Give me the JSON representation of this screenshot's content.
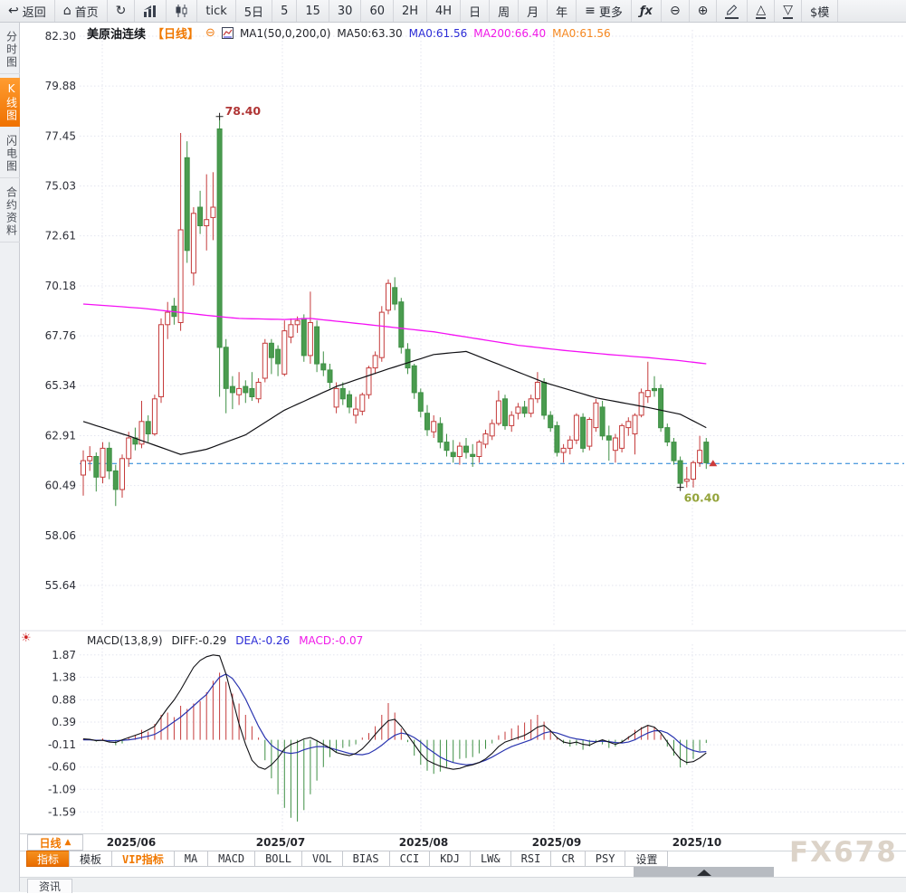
{
  "toolbar": {
    "items": [
      {
        "name": "back-button",
        "icon": "back-arrow-icon",
        "label": "返回"
      },
      {
        "name": "home-button",
        "icon": "home-icon",
        "label": "首页"
      },
      {
        "name": "refresh-button",
        "icon": "refresh-icon"
      },
      {
        "name": "bar-chart-button",
        "icon": "bar-chart-icon"
      },
      {
        "name": "candlestick-button",
        "icon": "candlestick-icon"
      },
      {
        "name": "period-tick-button",
        "label": "tick"
      },
      {
        "name": "period-5day-button",
        "label": "5日"
      },
      {
        "name": "period-5-button",
        "label": "5"
      },
      {
        "name": "period-15-button",
        "label": "15"
      },
      {
        "name": "period-30-button",
        "label": "30"
      },
      {
        "name": "period-60-button",
        "label": "60"
      },
      {
        "name": "period-2h-button",
        "label": "2H"
      },
      {
        "name": "period-4h-button",
        "label": "4H"
      },
      {
        "name": "period-day-button",
        "label": "日"
      },
      {
        "name": "period-week-button",
        "label": "周"
      },
      {
        "name": "period-month-button",
        "label": "月"
      },
      {
        "name": "period-year-button",
        "label": "年"
      },
      {
        "name": "more-button",
        "icon": "menu-icon",
        "label": "更多"
      },
      {
        "name": "fx-indicator-button",
        "icon": "fx-icon"
      },
      {
        "name": "zoom-out-button",
        "icon": "zoom-out-icon"
      },
      {
        "name": "zoom-in-button",
        "icon": "zoom-in-icon"
      },
      {
        "name": "draw-button",
        "icon": "pencil-icon"
      },
      {
        "name": "triangle-up-button",
        "icon": "triangle-up-icon"
      },
      {
        "name": "triangle-down-button",
        "icon": "triangle-down-icon"
      },
      {
        "name": "template-button",
        "label": "$模"
      }
    ]
  },
  "sidebar": {
    "items": [
      {
        "name": "sidebar-item-time-chart",
        "label": "分时图",
        "active": false
      },
      {
        "name": "sidebar-item-kline-chart",
        "label": "K线图",
        "active": true
      },
      {
        "name": "sidebar-item-lightning-chart",
        "label": "闪电图",
        "active": false
      },
      {
        "name": "sidebar-item-contract-info",
        "label": "合约资料",
        "active": false
      }
    ]
  },
  "chart_header": {
    "symbol": "美原油连续",
    "period": "【日线】",
    "ma_settings": "MA1(50,0,200,0)",
    "ma50_label": "MA50:63.30",
    "ma0_blue_label": "MA0:61.56",
    "ma200_label": "MA200:66.40",
    "ma0_orange_label": "MA0:61.56"
  },
  "macd_header": {
    "title": "MACD(13,8,9)",
    "diff_label": "DIFF:-0.29",
    "dea_label": "DEA:-0.26",
    "macd_label": "MACD:-0.07"
  },
  "annotations": {
    "high_label": "78.40",
    "low_label": "60.40"
  },
  "bottom": {
    "period_button": "日线",
    "news_tab": "资讯"
  },
  "tabs": [
    {
      "name": "tab-indicator",
      "label": "指标",
      "active": true,
      "vip": false
    },
    {
      "name": "tab-template",
      "label": "模板",
      "active": false,
      "vip": false
    },
    {
      "name": "tab-vip-indicator",
      "label": "VIP指标",
      "active": false,
      "vip": true
    },
    {
      "name": "tab-ma",
      "label": "MA",
      "active": false,
      "vip": false
    },
    {
      "name": "tab-macd",
      "label": "MACD",
      "active": false,
      "vip": false
    },
    {
      "name": "tab-boll",
      "label": "BOLL",
      "active": false,
      "vip": false
    },
    {
      "name": "tab-vol",
      "label": "VOL",
      "active": false,
      "vip": false
    },
    {
      "name": "tab-bias",
      "label": "BIAS",
      "active": false,
      "vip": false
    },
    {
      "name": "tab-cci",
      "label": "CCI",
      "active": false,
      "vip": false
    },
    {
      "name": "tab-kdj",
      "label": "KDJ",
      "active": false,
      "vip": false
    },
    {
      "name": "tab-lw",
      "label": "LW&",
      "active": false,
      "vip": false
    },
    {
      "name": "tab-rsi",
      "label": "RSI",
      "active": false,
      "vip": false
    },
    {
      "name": "tab-cr",
      "label": "CR",
      "active": false,
      "vip": false
    },
    {
      "name": "tab-psy",
      "label": "PSY",
      "active": false,
      "vip": false
    },
    {
      "name": "tab-settings",
      "label": "设置",
      "active": false,
      "vip": false
    }
  ],
  "watermark": "FX678",
  "colors": {
    "up_candle": "#c53b3b",
    "down_candle": "#4a9c4f",
    "ma50_line": "#101014",
    "ma200_line": "#f410f4",
    "diff_line": "#101014",
    "dea_line": "#2a35b0",
    "current_price_line": "#1a7fd4",
    "accent_orange": "#f07800",
    "high_label": "#b03535",
    "low_label": "#94a43b"
  },
  "chart_data": {
    "type": "candlestick+macd",
    "title": "美原油连续 日线 (WTI crude oil continuous, daily)",
    "y_axis": [
      82.3,
      79.88,
      77.45,
      75.03,
      72.61,
      70.18,
      67.76,
      65.34,
      62.91,
      60.49,
      58.06,
      55.64
    ],
    "macd_axis": [
      1.87,
      1.38,
      0.88,
      0.39,
      -0.11,
      -0.6,
      -1.09,
      -1.59
    ],
    "x_labels": [
      "2025/06",
      "2025/07",
      "2025/08",
      "2025/09",
      "2025/10"
    ],
    "current_price": 61.56,
    "high_marker": {
      "index": 21,
      "price": 78.4
    },
    "low_marker": {
      "index": 92,
      "price": 60.4
    },
    "indicator_values": {
      "ma50": 63.3,
      "ma200": 66.4,
      "ma0": 61.56,
      "diff": -0.29,
      "dea": -0.26,
      "macd": -0.07
    },
    "candles": [
      [
        61.0,
        62.2,
        60.0,
        61.7
      ],
      [
        61.7,
        62.4,
        61.2,
        61.9
      ],
      [
        61.9,
        62.1,
        60.2,
        60.9
      ],
      [
        60.9,
        62.6,
        60.6,
        62.3
      ],
      [
        62.3,
        62.6,
        60.8,
        61.2
      ],
      [
        61.2,
        61.5,
        59.5,
        60.3
      ],
      [
        60.3,
        62.0,
        59.9,
        61.8
      ],
      [
        61.8,
        63.1,
        61.4,
        62.8
      ],
      [
        62.8,
        63.3,
        62.2,
        62.5
      ],
      [
        62.5,
        64.6,
        62.3,
        63.6
      ],
      [
        63.6,
        63.9,
        62.6,
        63.0
      ],
      [
        63.0,
        64.9,
        62.9,
        64.7
      ],
      [
        64.8,
        68.6,
        64.5,
        68.3
      ],
      [
        68.3,
        69.4,
        67.6,
        68.9
      ],
      [
        69.2,
        69.6,
        68.3,
        68.7
      ],
      [
        68.4,
        77.6,
        68.0,
        72.9
      ],
      [
        76.4,
        77.2,
        71.3,
        71.9
      ],
      [
        70.8,
        74.0,
        70.2,
        73.7
      ],
      [
        74.0,
        74.8,
        72.7,
        73.1
      ],
      [
        73.1,
        75.6,
        71.9,
        73.4
      ],
      [
        73.5,
        75.7,
        72.4,
        74.0
      ],
      [
        77.8,
        78.4,
        64.8,
        67.2
      ],
      [
        67.2,
        67.6,
        64.0,
        65.2
      ],
      [
        65.3,
        65.8,
        64.2,
        65.0
      ],
      [
        64.9,
        66.0,
        64.4,
        65.2
      ],
      [
        65.3,
        65.6,
        64.5,
        65.0
      ],
      [
        65.2,
        66.0,
        64.6,
        64.8
      ],
      [
        64.7,
        65.7,
        64.5,
        65.5
      ],
      [
        65.7,
        67.6,
        65.5,
        67.4
      ],
      [
        67.4,
        67.6,
        65.9,
        66.7
      ],
      [
        67.1,
        67.3,
        65.8,
        66.4
      ],
      [
        65.9,
        68.5,
        65.8,
        68.0
      ],
      [
        67.7,
        68.6,
        67.4,
        68.3
      ],
      [
        68.3,
        68.7,
        67.9,
        68.5
      ],
      [
        68.6,
        68.8,
        66.5,
        66.8
      ],
      [
        66.8,
        69.9,
        66.4,
        68.4
      ],
      [
        68.2,
        68.5,
        66.0,
        66.4
      ],
      [
        66.4,
        67.0,
        65.8,
        66.1
      ],
      [
        66.1,
        66.4,
        65.2,
        65.5
      ],
      [
        64.3,
        65.5,
        64.0,
        65.2
      ],
      [
        65.2,
        65.5,
        64.4,
        64.7
      ],
      [
        64.9,
        65.1,
        64.0,
        64.3
      ],
      [
        63.9,
        64.8,
        63.5,
        64.2
      ],
      [
        64.1,
        65.0,
        63.9,
        64.9
      ],
      [
        64.9,
        66.3,
        64.7,
        66.2
      ],
      [
        66.2,
        67.0,
        65.9,
        66.8
      ],
      [
        66.7,
        69.2,
        66.5,
        68.9
      ],
      [
        69.0,
        70.5,
        68.8,
        70.3
      ],
      [
        70.1,
        70.6,
        69.0,
        69.3
      ],
      [
        69.4,
        69.6,
        66.9,
        67.2
      ],
      [
        67.1,
        67.4,
        65.9,
        66.2
      ],
      [
        66.3,
        66.4,
        64.7,
        65.0
      ],
      [
        65.0,
        65.2,
        63.8,
        64.1
      ],
      [
        64.0,
        64.4,
        62.9,
        63.2
      ],
      [
        63.1,
        63.9,
        62.8,
        63.6
      ],
      [
        63.5,
        63.8,
        62.3,
        62.6
      ],
      [
        62.6,
        63.0,
        61.9,
        62.2
      ],
      [
        62.1,
        62.7,
        61.6,
        61.9
      ],
      [
        61.9,
        62.6,
        61.5,
        62.4
      ],
      [
        62.4,
        62.8,
        61.8,
        62.1
      ],
      [
        62.0,
        62.5,
        61.4,
        61.9
      ],
      [
        61.9,
        62.7,
        61.6,
        62.6
      ],
      [
        62.5,
        63.2,
        62.3,
        63.0
      ],
      [
        62.9,
        63.7,
        62.7,
        63.5
      ],
      [
        63.5,
        65.1,
        63.4,
        64.6
      ],
      [
        64.7,
        64.9,
        63.2,
        63.4
      ],
      [
        63.4,
        64.1,
        63.1,
        63.9
      ],
      [
        64.0,
        64.5,
        63.7,
        64.3
      ],
      [
        64.3,
        64.6,
        63.8,
        64.0
      ],
      [
        64.0,
        64.9,
        63.8,
        64.7
      ],
      [
        64.7,
        66.0,
        64.5,
        65.5
      ],
      [
        65.5,
        65.7,
        63.7,
        63.9
      ],
      [
        63.9,
        64.1,
        63.1,
        63.3
      ],
      [
        63.4,
        63.6,
        61.9,
        62.1
      ],
      [
        62.1,
        62.5,
        61.6,
        62.3
      ],
      [
        62.3,
        62.9,
        62.0,
        62.7
      ],
      [
        62.7,
        64.0,
        62.5,
        63.9
      ],
      [
        63.8,
        64.0,
        62.1,
        62.3
      ],
      [
        62.4,
        63.8,
        62.2,
        63.7
      ],
      [
        63.3,
        64.7,
        63.1,
        64.5
      ],
      [
        64.3,
        64.6,
        62.7,
        62.9
      ],
      [
        62.9,
        63.4,
        61.7,
        62.7
      ],
      [
        62.2,
        63.0,
        61.6,
        62.8
      ],
      [
        62.3,
        63.5,
        62.1,
        63.4
      ],
      [
        63.3,
        63.8,
        62.9,
        63.6
      ],
      [
        63.0,
        64.0,
        62.0,
        63.9
      ],
      [
        63.9,
        65.2,
        63.8,
        65.0
      ],
      [
        64.8,
        66.5,
        64.5,
        65.1
      ],
      [
        65.2,
        65.8,
        64.8,
        65.1
      ],
      [
        65.2,
        65.4,
        63.1,
        63.3
      ],
      [
        63.3,
        63.5,
        62.4,
        62.6
      ],
      [
        62.6,
        62.8,
        61.5,
        61.7
      ],
      [
        61.7,
        61.9,
        60.4,
        60.6
      ],
      [
        60.7,
        61.4,
        60.4,
        60.8
      ],
      [
        60.8,
        61.7,
        60.4,
        61.6
      ],
      [
        61.6,
        62.9,
        61.4,
        62.2
      ],
      [
        62.6,
        62.8,
        61.3,
        61.6
      ]
    ],
    "ma50_anchors": [
      [
        0,
        63.6
      ],
      [
        7,
        62.9
      ],
      [
        15,
        62.0
      ],
      [
        19,
        62.25
      ],
      [
        25,
        62.95
      ],
      [
        31,
        64.15
      ],
      [
        39,
        65.3
      ],
      [
        47,
        66.15
      ],
      [
        54,
        66.85
      ],
      [
        59,
        67.0
      ],
      [
        65,
        66.25
      ],
      [
        71,
        65.5
      ],
      [
        79,
        64.75
      ],
      [
        87,
        64.28
      ],
      [
        92,
        63.95
      ],
      [
        96,
        63.3
      ]
    ],
    "ma200_anchors": [
      [
        0,
        69.3
      ],
      [
        9,
        69.1
      ],
      [
        19,
        68.75
      ],
      [
        24,
        68.6
      ],
      [
        31,
        68.55
      ],
      [
        35,
        68.6
      ],
      [
        44,
        68.3
      ],
      [
        54,
        67.95
      ],
      [
        61,
        67.6
      ],
      [
        67,
        67.3
      ],
      [
        74,
        67.05
      ],
      [
        81,
        66.85
      ],
      [
        87,
        66.7
      ],
      [
        92,
        66.55
      ],
      [
        96,
        66.4
      ]
    ],
    "macd": {
      "hist": [
        0.02,
        0.01,
        -0.04,
        0.03,
        -0.05,
        -0.12,
        -0.08,
        0.06,
        0.1,
        0.22,
        0.18,
        0.35,
        0.55,
        0.6,
        0.5,
        0.75,
        0.68,
        0.8,
        0.85,
        1.05,
        1.3,
        1.48,
        1.28,
        1.02,
        0.8,
        0.55,
        0.3,
        0.05,
        -0.45,
        -0.85,
        -1.2,
        -1.5,
        -1.72,
        -1.8,
        -1.55,
        -1.2,
        -0.9,
        -0.6,
        -0.38,
        -0.28,
        -0.18,
        -0.15,
        -0.1,
        0.05,
        0.15,
        0.3,
        0.55,
        0.81,
        0.6,
        0.25,
        -0.05,
        -0.35,
        -0.55,
        -0.68,
        -0.75,
        -0.7,
        -0.6,
        -0.5,
        -0.42,
        -0.4,
        -0.38,
        -0.3,
        -0.2,
        -0.08,
        0.1,
        0.18,
        0.25,
        0.32,
        0.38,
        0.45,
        0.55,
        0.4,
        0.22,
        0.05,
        -0.08,
        -0.15,
        -0.12,
        -0.22,
        -0.15,
        -0.05,
        -0.1,
        -0.18,
        -0.15,
        -0.05,
        0.08,
        0.22,
        0.28,
        0.32,
        0.28,
        0.12,
        -0.15,
        -0.35,
        -0.61,
        -0.55,
        -0.42,
        -0.25,
        -0.07
      ],
      "diff": [
        0.02,
        0.01,
        -0.02,
        -0.01,
        -0.05,
        -0.06,
        0.0,
        0.05,
        0.1,
        0.15,
        0.22,
        0.3,
        0.5,
        0.7,
        0.88,
        1.1,
        1.35,
        1.6,
        1.75,
        1.83,
        1.87,
        1.85,
        1.45,
        0.9,
        0.35,
        -0.1,
        -0.45,
        -0.6,
        -0.65,
        -0.55,
        -0.4,
        -0.2,
        -0.1,
        -0.05,
        0.02,
        0.05,
        -0.02,
        -0.1,
        -0.18,
        -0.28,
        -0.32,
        -0.35,
        -0.3,
        -0.2,
        -0.05,
        0.12,
        0.28,
        0.42,
        0.45,
        0.3,
        0.1,
        -0.1,
        -0.3,
        -0.45,
        -0.52,
        -0.58,
        -0.62,
        -0.65,
        -0.63,
        -0.58,
        -0.55,
        -0.5,
        -0.42,
        -0.3,
        -0.15,
        -0.05,
        0.0,
        0.05,
        0.1,
        0.18,
        0.28,
        0.32,
        0.2,
        0.05,
        -0.05,
        -0.08,
        -0.05,
        -0.1,
        -0.12,
        -0.05,
        0.0,
        -0.05,
        -0.1,
        -0.05,
        0.05,
        0.15,
        0.25,
        0.32,
        0.28,
        0.15,
        -0.05,
        -0.25,
        -0.42,
        -0.5,
        -0.48,
        -0.4,
        -0.29
      ],
      "dea": [
        0.0,
        0.0,
        -0.01,
        -0.01,
        -0.02,
        -0.02,
        -0.01,
        0.0,
        0.02,
        0.05,
        0.08,
        0.12,
        0.2,
        0.3,
        0.4,
        0.5,
        0.62,
        0.75,
        0.88,
        1.0,
        1.2,
        1.38,
        1.45,
        1.35,
        1.15,
        0.9,
        0.6,
        0.3,
        0.05,
        -0.12,
        -0.22,
        -0.28,
        -0.3,
        -0.28,
        -0.22,
        -0.18,
        -0.15,
        -0.15,
        -0.18,
        -0.22,
        -0.26,
        -0.3,
        -0.32,
        -0.33,
        -0.3,
        -0.22,
        -0.12,
        0.0,
        0.1,
        0.15,
        0.12,
        0.05,
        -0.05,
        -0.18,
        -0.28,
        -0.38,
        -0.45,
        -0.5,
        -0.53,
        -0.55,
        -0.54,
        -0.5,
        -0.45,
        -0.38,
        -0.3,
        -0.22,
        -0.15,
        -0.1,
        -0.05,
        0.0,
        0.08,
        0.15,
        0.18,
        0.15,
        0.1,
        0.05,
        0.02,
        0.0,
        -0.03,
        -0.04,
        -0.03,
        -0.04,
        -0.06,
        -0.07,
        -0.05,
        0.0,
        0.08,
        0.15,
        0.2,
        0.2,
        0.15,
        0.05,
        -0.08,
        -0.18,
        -0.24,
        -0.27,
        -0.26
      ]
    }
  }
}
